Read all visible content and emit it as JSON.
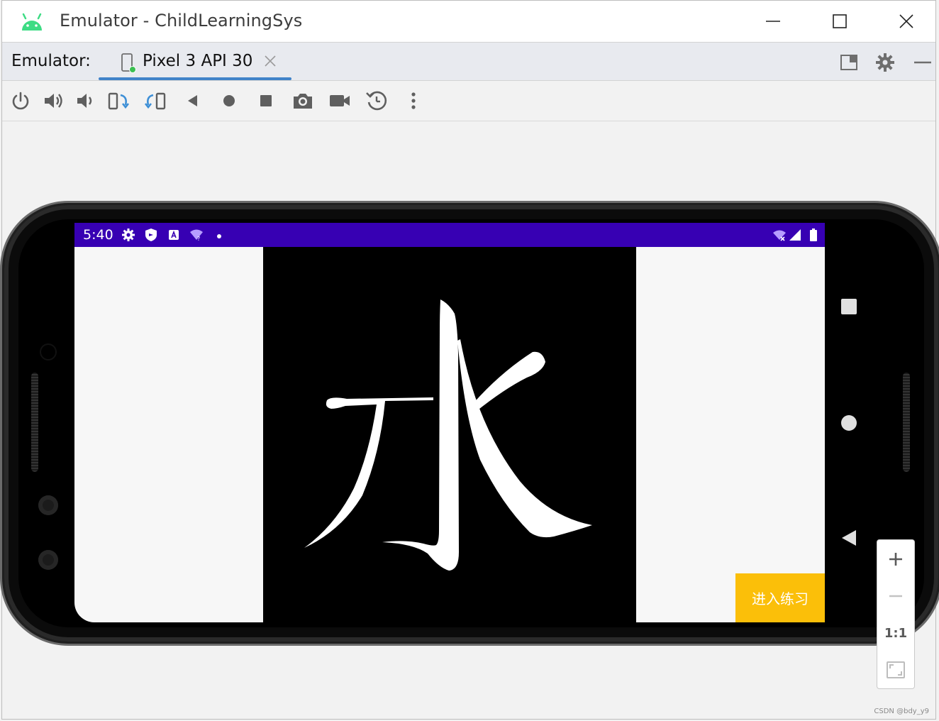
{
  "window": {
    "title": "Emulator - ChildLearningSys"
  },
  "tabbar": {
    "prefix": "Emulator:",
    "active_tab": "Pixel 3 API 30"
  },
  "toolbar": {
    "icons": [
      "power-icon",
      "volume-up-icon",
      "volume-down-icon",
      "rotate-left-icon",
      "rotate-right-icon",
      "back-icon",
      "home-icon",
      "overview-icon",
      "screenshot-icon",
      "screen-record-icon",
      "snapshot-icon",
      "more-icon"
    ]
  },
  "phone": {
    "status": {
      "time": "5:40"
    },
    "app": {
      "character": "水",
      "practice_button": "进入练习"
    }
  },
  "zoom": {
    "one_to_one": "1:1"
  },
  "watermark": "CSDN @bdy_y9",
  "colors": {
    "status_bar": "#3700b3",
    "practice_button": "#fbbf09",
    "tab_underline": "#4083c9",
    "android_green": "#3ddc84"
  }
}
